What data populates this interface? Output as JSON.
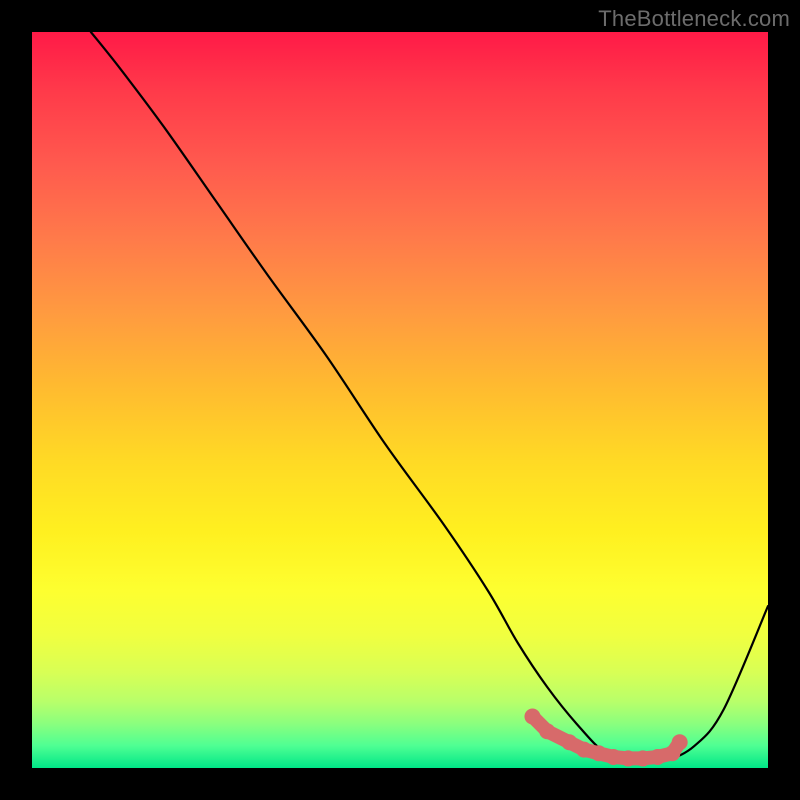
{
  "watermark": "TheBottleneck.com",
  "chart_data": {
    "type": "line",
    "title": "",
    "xlabel": "",
    "ylabel": "",
    "xlim": [
      0,
      100
    ],
    "ylim": [
      0,
      100
    ],
    "grid": false,
    "legend": false,
    "series": [
      {
        "name": "curve",
        "color": "#000000",
        "x": [
          8,
          12,
          18,
          25,
          32,
          40,
          48,
          56,
          62,
          66,
          70,
          74,
          78,
          82,
          86,
          90,
          94,
          100
        ],
        "y": [
          100,
          95,
          87,
          77,
          67,
          56,
          44,
          33,
          24,
          17,
          11,
          6,
          2,
          1,
          1,
          3,
          8,
          22
        ]
      },
      {
        "name": "highlight-dots",
        "color": "#d76a6a",
        "x": [
          68,
          70,
          73,
          75,
          77,
          79,
          81,
          83,
          85,
          87,
          88
        ],
        "y": [
          7,
          5,
          3.5,
          2.5,
          2,
          1.5,
          1.3,
          1.3,
          1.5,
          2,
          3.5
        ]
      }
    ]
  },
  "colors": {
    "background": "#000000",
    "curve": "#000000",
    "dots": "#d76a6a"
  }
}
